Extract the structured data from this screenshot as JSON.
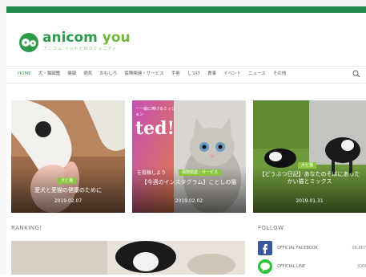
{
  "site": {
    "brand": "anicom",
    "brand_suffix": "you",
    "tagline": "アニコム ペットとのコミュニティ"
  },
  "nav": {
    "items": [
      {
        "label": "HOME",
        "active": true
      },
      {
        "label": "犬・猫図鑑"
      },
      {
        "label": "健康"
      },
      {
        "label": "病気"
      },
      {
        "label": "おもしろ"
      },
      {
        "label": "保険関連・サービス"
      },
      {
        "label": "手術"
      },
      {
        "label": "しつけ"
      },
      {
        "label": "食事"
      },
      {
        "label": "イベント"
      },
      {
        "label": "ニュース"
      },
      {
        "label": "その他"
      }
    ]
  },
  "cards": [
    {
      "tag": "犬と猫",
      "title": "愛犬と愛猫の健康のために",
      "date": "2019.02.07"
    },
    {
      "tag": "保険関連・サービス",
      "title": "【今週のインスタグラム】ことしの猫",
      "date": "2019.02.02",
      "banner": "ted!",
      "banner_sub": "ーー様に捧げるミッション",
      "left_text": "を投稿しよう"
    },
    {
      "tag": "犬と猫",
      "title": "【どうぶつ日記】あなたのそばにあったかい猫とミックス",
      "date": "2019.01.31"
    }
  ],
  "sections": {
    "ranking": "RANKING!",
    "follow": "FOLLOW"
  },
  "follow": [
    {
      "label": "OFFICIAL FACEBOOK",
      "count": "98,867",
      "color": "#3b5998"
    },
    {
      "label": "OFFICIAL LINE",
      "count": "JOIN",
      "color": "#2ec33d"
    }
  ]
}
